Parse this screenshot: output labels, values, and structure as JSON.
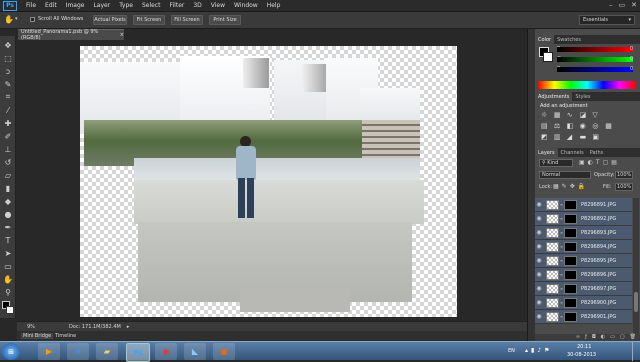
{
  "menu": {
    "logo": "Ps",
    "items": [
      "File",
      "Edit",
      "Image",
      "Layer",
      "Type",
      "Select",
      "Filter",
      "3D",
      "View",
      "Window",
      "Help"
    ],
    "window_controls": [
      "–",
      "▭",
      "✕"
    ]
  },
  "options": {
    "scroll_all": "Scroll All Windows",
    "actual_pixels": "Actual Pixels",
    "fit_screen": "Fit Screen",
    "fill_screen": "Fill Screen",
    "print_size": "Print Size",
    "workspace": "Essentials"
  },
  "document": {
    "tab_title": "Untitled_Panorama1.psb @ 9% (RGB/8)",
    "tab_close": "×"
  },
  "status": {
    "zoom": "9%",
    "doc": "Doc: 171.1M/382.4M"
  },
  "bottom_tabs": [
    "Mini Bridge",
    "Timeline"
  ],
  "color_panel": {
    "tabs": [
      "Color",
      "Swatches"
    ],
    "r": "R",
    "g": "G",
    "b": "B",
    "r_val": "0",
    "g_val": "0",
    "b_val": "0"
  },
  "adjustments": {
    "tabs": [
      "Adjustments",
      "Styles"
    ],
    "heading": "Add an adjustment"
  },
  "layers": {
    "tabs": [
      "Layers",
      "Channels",
      "Paths"
    ],
    "filter_kind": "Kind",
    "blend_mode": "Normal",
    "opacity_label": "Opacity:",
    "opacity": "100%",
    "lock_label": "Lock:",
    "fill_label": "Fill:",
    "fill": "100%",
    "items": [
      {
        "name": "P8296891.JPG"
      },
      {
        "name": "P8296892.JPG"
      },
      {
        "name": "P8296893.JPG"
      },
      {
        "name": "P8296894.JPG"
      },
      {
        "name": "P8296895.JPG"
      },
      {
        "name": "P8296896.JPG"
      },
      {
        "name": "P8296897.JPG"
      },
      {
        "name": "P8296900.JPG"
      },
      {
        "name": "P8296901.JPG"
      }
    ]
  },
  "taskbar": {
    "lang": "EN",
    "time": "20:11",
    "date": "30-08-2013",
    "apps": [
      "start",
      "media",
      "explorer",
      "files",
      "photoshop",
      "chrome",
      "notes",
      "office"
    ]
  },
  "colors": {
    "accent": "#31a8ff",
    "canvas_bg": "#282828",
    "panel_bg": "#4b4b4b",
    "selected_layer": "#4b5a6e"
  }
}
